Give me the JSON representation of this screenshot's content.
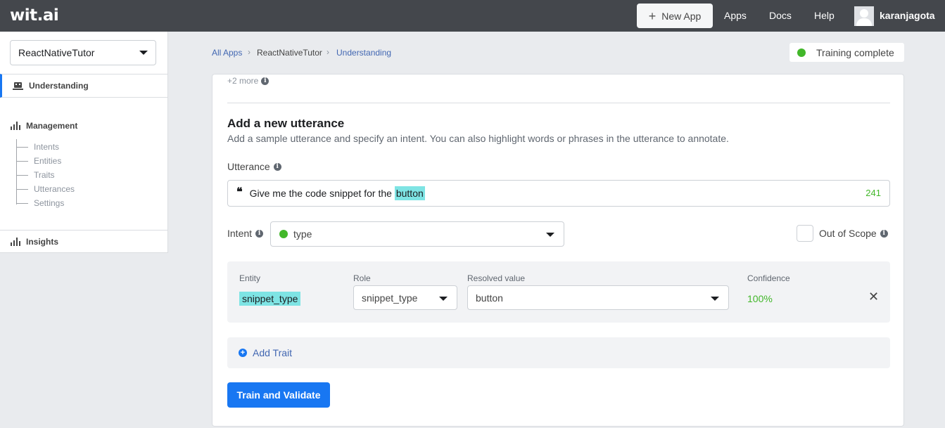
{
  "header": {
    "logo": "wit.ai",
    "new_app_label": "New App",
    "nav": [
      "Apps",
      "Docs",
      "Help"
    ],
    "username": "karanjagota"
  },
  "sidebar": {
    "app_selected": "ReactNativeTutor",
    "understanding_label": "Understanding",
    "management_label": "Management",
    "management_items": [
      "Intents",
      "Entities",
      "Traits",
      "Utterances",
      "Settings"
    ],
    "insights_label": "Insights"
  },
  "breadcrumb": {
    "items": [
      "All Apps",
      "ReactNativeTutor",
      "Understanding"
    ]
  },
  "status": {
    "text": "Training complete",
    "color": "#42b72a"
  },
  "card": {
    "more_text": "+2 more",
    "title": "Add a new utterance",
    "description": "Add a sample utterance and specify an intent. You can also highlight words or phrases in the utterance to annotate.",
    "utterance_label": "Utterance",
    "utterance_text": "Give me the code snippet for the ",
    "utterance_highlight": "button",
    "char_count": "241",
    "intent_label": "Intent",
    "intent_value": "type",
    "out_of_scope_label": "Out of Scope",
    "entity_headers": {
      "entity": "Entity",
      "role": "Role",
      "resolved": "Resolved value",
      "confidence": "Confidence"
    },
    "entity_row": {
      "entity": "snippet_type",
      "role": "snippet_type",
      "resolved": "button",
      "confidence": "100%"
    },
    "add_trait_label": "Add Trait",
    "train_button": "Train and Validate"
  },
  "colors": {
    "accent": "#1877f2",
    "highlight": "#7ee4e4",
    "topbar": "#44474c"
  }
}
